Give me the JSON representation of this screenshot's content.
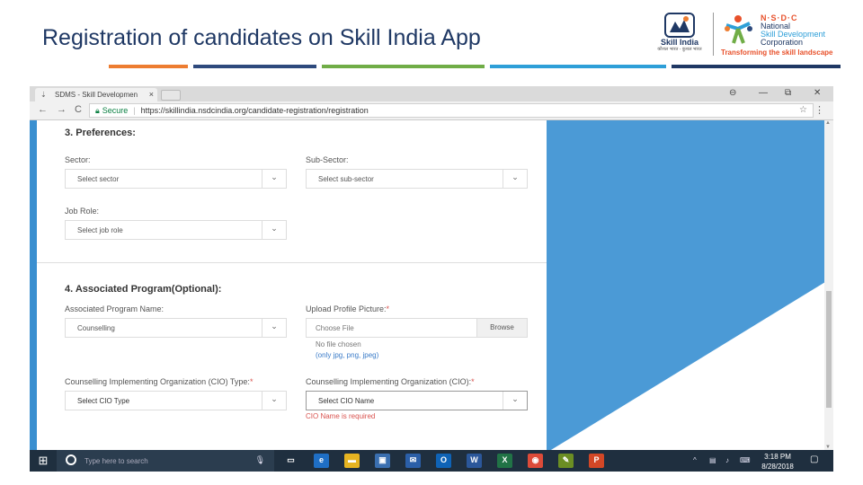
{
  "slide": {
    "title": "Registration of candidates on Skill India App",
    "accent_bars": [
      "#ed7d31",
      "#2e4a7d",
      "#70ad47",
      "#2e9fd8",
      "#1f3864"
    ],
    "logo_skill_india": {
      "name": "Skill India",
      "tagline": "कौशल भारत - कुशल भारत"
    },
    "logo_nsdc": {
      "acronym": "N·S·D·C",
      "line1": "National",
      "line2": "Skill Development",
      "line3": "Corporation",
      "tagline": "Transforming the skill landscape"
    }
  },
  "browser": {
    "tab_title": "SDMS - Skill Developmen",
    "tab_close": "×",
    "window_controls": {
      "account": "⊖",
      "minimize": "—",
      "restore": "⧉",
      "close": "✕"
    },
    "nav": {
      "back": "←",
      "forward": "→",
      "reload": "C"
    },
    "security_label": "Secure",
    "url": "https://skillindia.nsdcindia.org/candidate-registration/registration",
    "star": "☆",
    "menu": "⋮"
  },
  "form": {
    "preferences": {
      "heading": "3. Preferences:",
      "sector_label": "Sector:",
      "sector_value": "Select sector",
      "subsector_label": "Sub-Sector:",
      "subsector_value": "Select sub-sector",
      "jobrole_label": "Job Role:",
      "jobrole_value": "Select job role"
    },
    "associated": {
      "heading": "4. Associated Program(Optional):",
      "program_label": "Associated Program Name:",
      "program_value": "Counselling",
      "upload_label": "Upload Profile Picture:",
      "upload_required": "*",
      "choose_file": "Choose File",
      "browse": "Browse",
      "no_file": "No file chosen",
      "allowed": "(only jpg, png, jpeg)",
      "cio_type_label": "Counselling Implementing Organization (CIO) Type:",
      "cio_type_required": "*",
      "cio_type_value": "Select CIO Type",
      "cio_name_label": "Counselling Implementing Organization (CIO):",
      "cio_name_required": "*",
      "cio_name_value": "Select CIO Name",
      "cio_name_error": "CIO Name is required"
    }
  },
  "taskbar": {
    "search_placeholder": "Type here to search",
    "apps": [
      {
        "name": "task-view",
        "glyph": "▭",
        "color": "#1f2f3f"
      },
      {
        "name": "edge",
        "glyph": "e",
        "color": "#1f6fc5"
      },
      {
        "name": "file-explorer",
        "glyph": "▬",
        "color": "#e6b422"
      },
      {
        "name": "store",
        "glyph": "▣",
        "color": "#3a6fb0"
      },
      {
        "name": "mail",
        "glyph": "✉",
        "color": "#2b5fa8"
      },
      {
        "name": "outlook",
        "glyph": "O",
        "color": "#0f63b6"
      },
      {
        "name": "word",
        "glyph": "W",
        "color": "#2b579a"
      },
      {
        "name": "excel",
        "glyph": "X",
        "color": "#217346"
      },
      {
        "name": "chrome",
        "glyph": "◉",
        "color": "#dd4b39"
      },
      {
        "name": "paint",
        "glyph": "✎",
        "color": "#6b8e23"
      },
      {
        "name": "powerpoint",
        "glyph": "P",
        "color": "#d24726"
      }
    ],
    "time": "3:18 PM",
    "date": "8/28/2018"
  }
}
